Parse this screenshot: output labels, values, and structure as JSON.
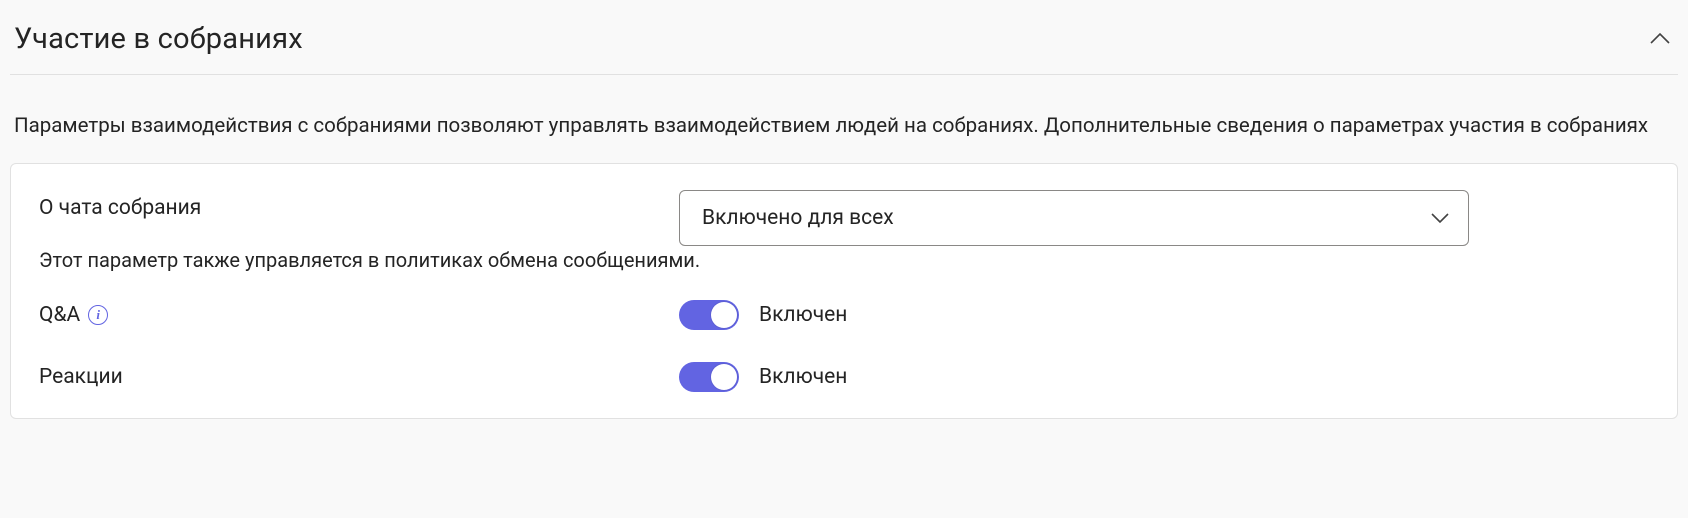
{
  "section": {
    "title": "Участие в собраниях",
    "description": "Параметры взаимодействия с собраниями позволяют управлять взаимодействием людей на собраниях. Дополнительные сведения о параметрах участия в собраниях"
  },
  "rows": {
    "chat": {
      "label": "О чата собрания",
      "helper": "Этот параметр также управляется в политиках обмена сообщениями.",
      "selected": "Включено для всех"
    },
    "qa": {
      "label": "Q&A",
      "status": "Включен",
      "on": true
    },
    "reactions": {
      "label": "Реакции",
      "status": "Включен",
      "on": true
    }
  },
  "colors": {
    "accent": "#6264e2"
  }
}
